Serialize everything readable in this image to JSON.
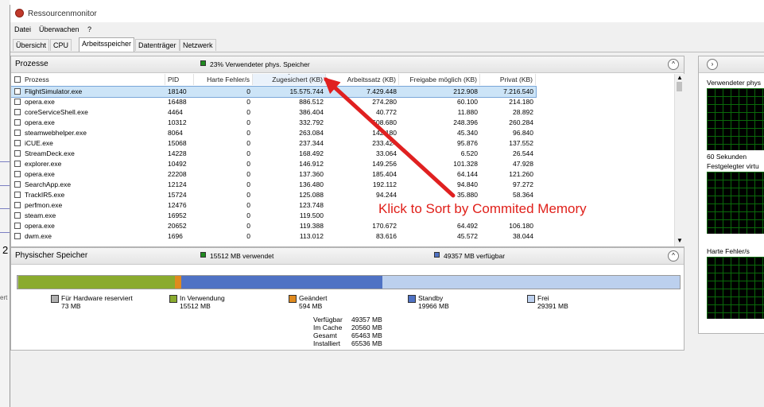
{
  "window": {
    "title": "Ressourcenmonitor"
  },
  "menu": [
    "Datei",
    "Überwachen",
    "?"
  ],
  "tabs": [
    {
      "label": "Übersicht",
      "active": false
    },
    {
      "label": "CPU",
      "active": false
    },
    {
      "label": "Arbeitsspeicher",
      "active": true
    },
    {
      "label": "Datenträger",
      "active": false
    },
    {
      "label": "Netzwerk",
      "active": false
    }
  ],
  "processes": {
    "title": "Prozesse",
    "summary": "23% Verwendeter phys. Speicher",
    "columns": [
      "Prozess",
      "PID",
      "Harte Fehler/s",
      "Zugesichert (KB)",
      "Arbeitssatz (KB)",
      "Freigabe möglich (KB)",
      "Privat (KB)"
    ],
    "rows": [
      [
        "FlightSimulator.exe",
        "18140",
        "0",
        "15.575.744",
        "7.429.448",
        "212.908",
        "7.216.540"
      ],
      [
        "opera.exe",
        "16488",
        "0",
        "886.512",
        "274.280",
        "60.100",
        "214.180"
      ],
      [
        "coreServiceShell.exe",
        "4464",
        "0",
        "386.404",
        "40.772",
        "11.880",
        "28.892"
      ],
      [
        "opera.exe",
        "10312",
        "0",
        "332.792",
        "508.680",
        "248.396",
        "260.284"
      ],
      [
        "steamwebhelper.exe",
        "8064",
        "0",
        "263.084",
        "142.180",
        "45.340",
        "96.840"
      ],
      [
        "iCUE.exe",
        "15068",
        "0",
        "237.344",
        "233.424",
        "95.876",
        "137.552"
      ],
      [
        "StreamDeck.exe",
        "14228",
        "0",
        "168.492",
        "33.064",
        "6.520",
        "26.544"
      ],
      [
        "explorer.exe",
        "10492",
        "0",
        "146.912",
        "149.256",
        "101.328",
        "47.928"
      ],
      [
        "opera.exe",
        "22208",
        "0",
        "137.360",
        "185.404",
        "64.144",
        "121.260"
      ],
      [
        "SearchApp.exe",
        "12124",
        "0",
        "136.480",
        "192.112",
        "94.840",
        "97.272"
      ],
      [
        "TrackIR5.exe",
        "15724",
        "0",
        "125.088",
        "94.244",
        "35.880",
        "58.364"
      ],
      [
        "perfmon.exe",
        "12476",
        "0",
        "123.748",
        "",
        "",
        ""
      ],
      [
        "steam.exe",
        "16952",
        "0",
        "119.500",
        "10",
        "",
        ""
      ],
      [
        "opera.exe",
        "20652",
        "0",
        "119.388",
        "170.672",
        "64.492",
        "106.180"
      ],
      [
        "dwm.exe",
        "1696",
        "0",
        "113.012",
        "83.616",
        "45.572",
        "38.044"
      ]
    ]
  },
  "annotation": {
    "text": "Klick to Sort by Commited Memory"
  },
  "physical": {
    "title": "Physischer Speicher",
    "used_text": "15512 MB verwendet",
    "avail_text": "49357 MB verfügbar",
    "bar_mb": {
      "hardware_reserved": 73,
      "in_use": 15512,
      "modified": 594,
      "standby": 19966,
      "free": 29391
    },
    "legend": [
      {
        "label": "Für Hardware reserviert",
        "value": "73 MB",
        "color": "#b0b0b0"
      },
      {
        "label": "In Verwendung",
        "value": "15512 MB",
        "color": "#8aab2e"
      },
      {
        "label": "Geändert",
        "value": "594 MB",
        "color": "#e08a1e"
      },
      {
        "label": "Standby",
        "value": "19966 MB",
        "color": "#4f72c4"
      },
      {
        "label": "Frei",
        "value": "29391 MB",
        "color": "#bcd0ee"
      }
    ],
    "stats": [
      {
        "label": "Verfügbar",
        "value": "49357 MB"
      },
      {
        "label": "Im Cache",
        "value": "20560 MB"
      },
      {
        "label": "Gesamt",
        "value": "65463 MB"
      },
      {
        "label": "Installiert",
        "value": "65536 MB"
      }
    ]
  },
  "right_panel": {
    "graph1_label": "Verwendeter phys",
    "time_label": "60 Sekunden",
    "graph2_label": "Festgelegter virtu",
    "graph3_label": "Harte Fehler/s"
  },
  "left_strip": {
    "digit": "2",
    "text": "ert"
  }
}
